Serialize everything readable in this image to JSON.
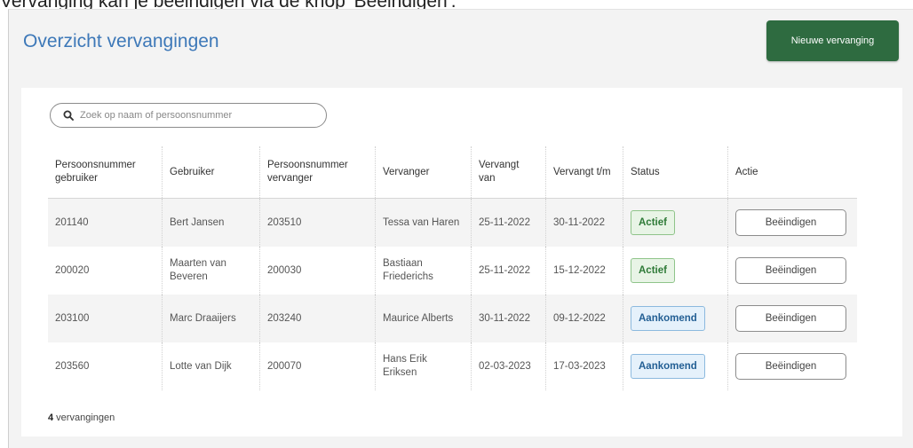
{
  "top_caption": "Vervanging kan je beëindigen via de knop 'Beëindigen'.",
  "page_title": "Overzicht vervangingen",
  "new_button_label": "Nieuwe vervanging",
  "search": {
    "placeholder": "Zoek op naam of persoonsnummer",
    "value": ""
  },
  "table": {
    "columns": [
      "Persoonsnummer gebruiker",
      "Gebruiker",
      "Persoonsnummer vervanger",
      "Vervanger",
      "Vervangt van",
      "Vervangt t/m",
      "Status",
      "Actie"
    ],
    "rows": [
      {
        "user_id": "201140",
        "user": "Bert Jansen",
        "sub_id": "203510",
        "sub": "Tessa van Haren",
        "from": "25-11-2022",
        "to": "30-11-2022",
        "status": "Actief",
        "action": "Beëindigen"
      },
      {
        "user_id": "200020",
        "user": "Maarten van Beveren",
        "sub_id": "200030",
        "sub": "Bastiaan Friederichs",
        "from": "25-11-2022",
        "to": "15-12-2022",
        "status": "Actief",
        "action": "Beëindigen"
      },
      {
        "user_id": "203100",
        "user": "Marc Draaijers",
        "sub_id": "203240",
        "sub": "Maurice Alberts",
        "from": "30-11-2022",
        "to": "09-12-2022",
        "status": "Aankomend",
        "action": "Beëindigen"
      },
      {
        "user_id": "203560",
        "user": "Lotte van Dijk",
        "sub_id": "200070",
        "sub": "Hans Erik Eriksen",
        "from": "02-03-2023",
        "to": "17-03-2023",
        "status": "Aankomend",
        "action": "Beëindigen"
      }
    ]
  },
  "footer": {
    "count": "4",
    "label": " vervangingen"
  },
  "colors": {
    "title_blue": "#3d78b8",
    "primary_green": "#2e6b40",
    "status_active": "#2e7a37",
    "status_upcoming": "#235f94"
  },
  "icons": {
    "search": "search-icon"
  }
}
